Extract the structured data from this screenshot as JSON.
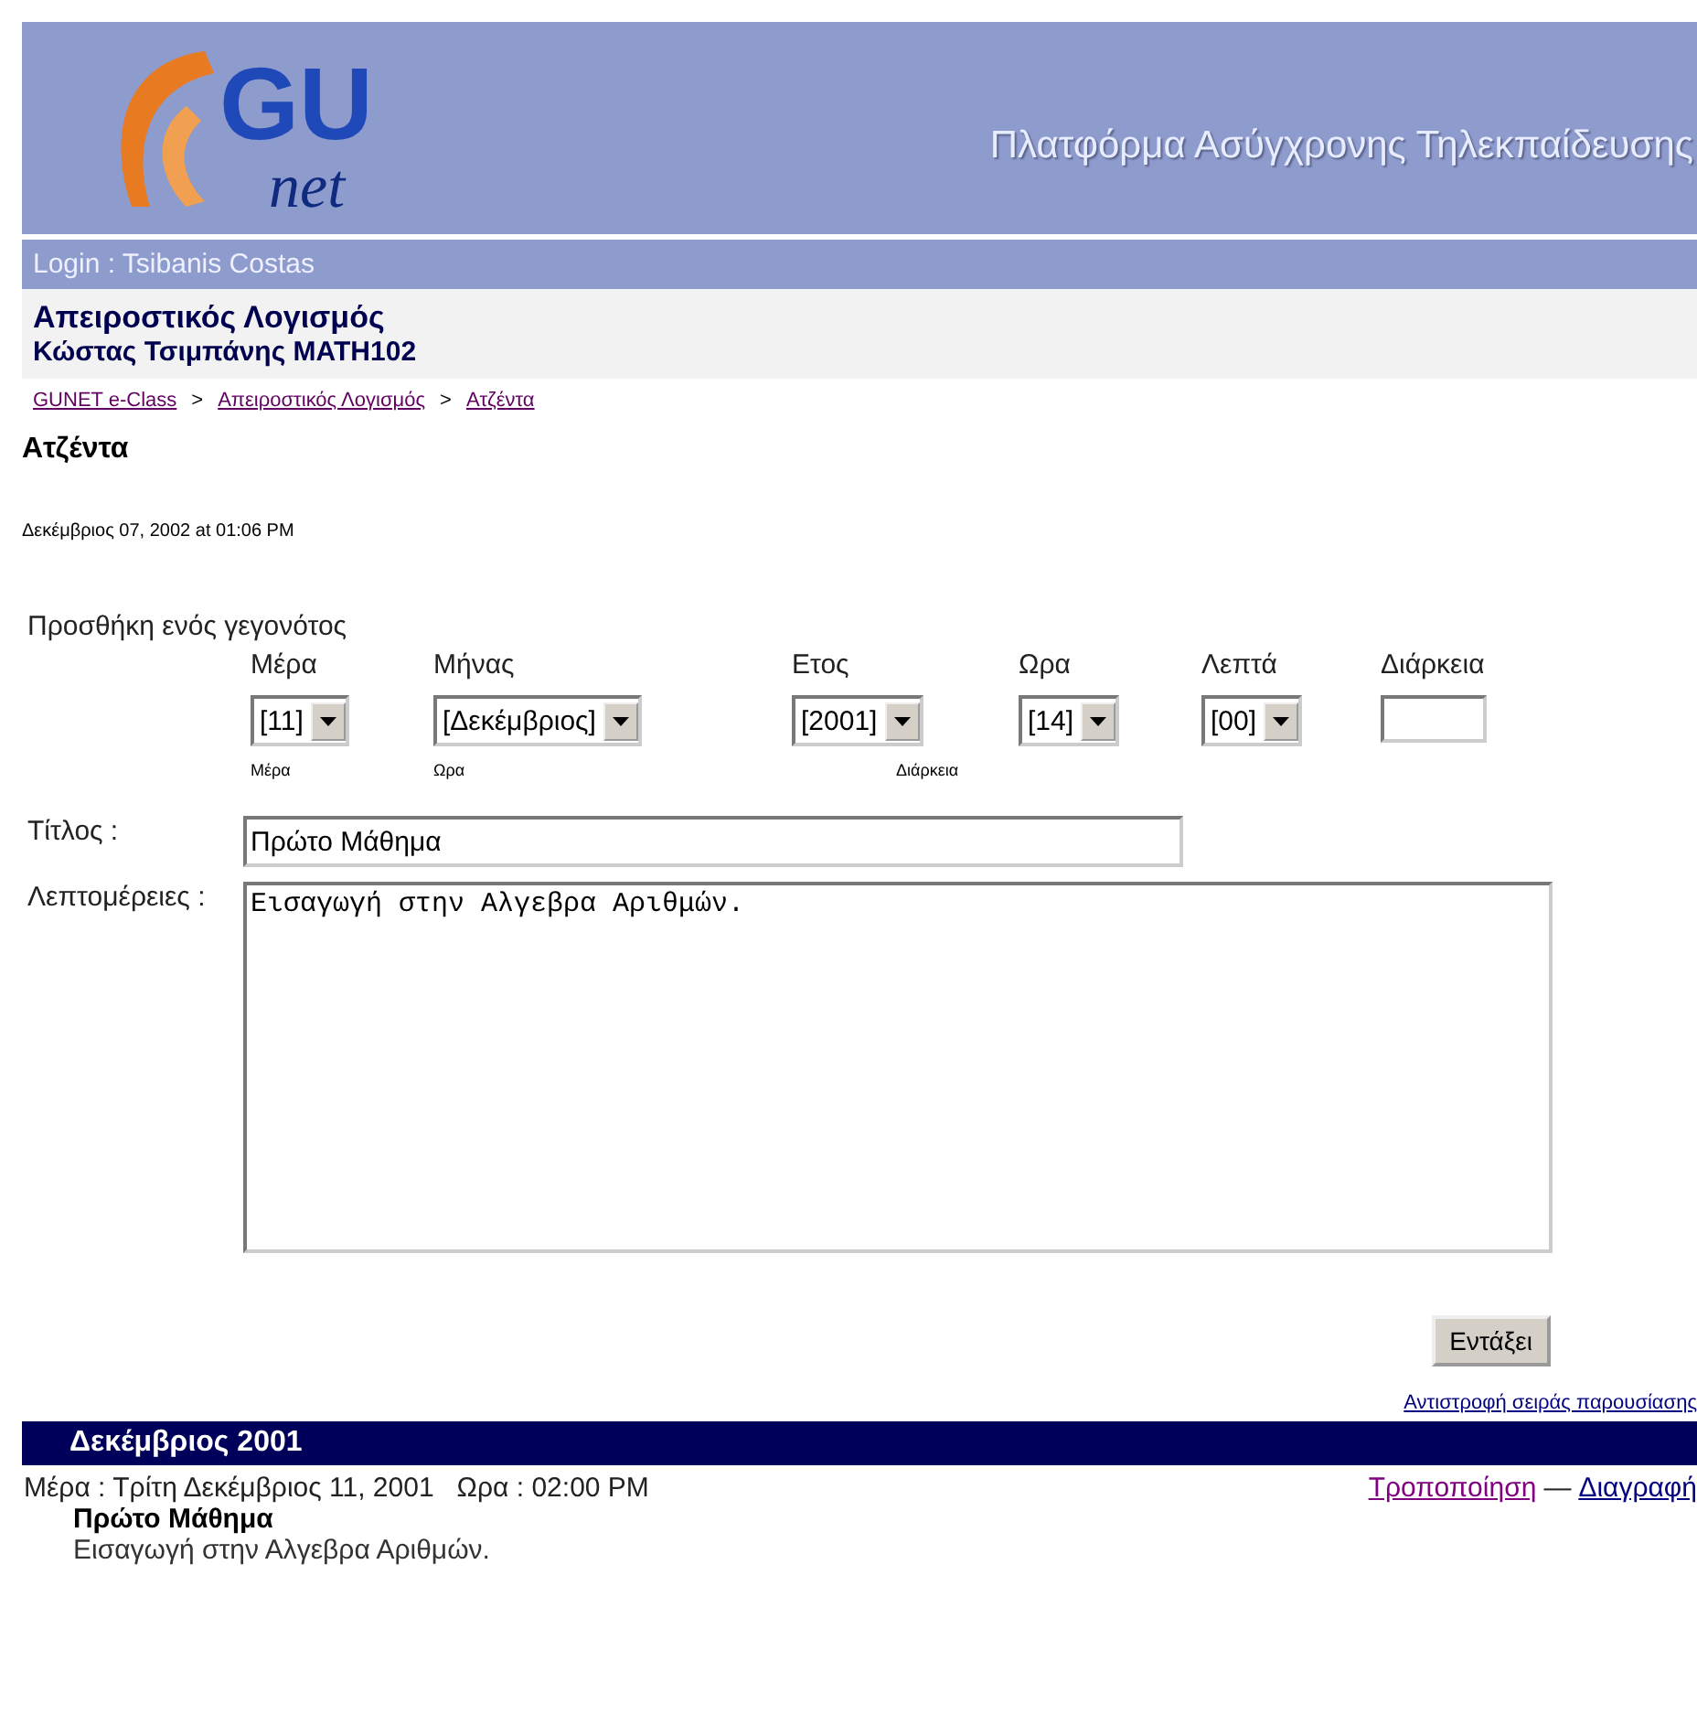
{
  "header": {
    "logo_main": "GU",
    "logo_sub": "net",
    "tagline": "Πλατφόρμα Ασύγχρονης Τηλεκπαίδευσης"
  },
  "login": "Login : Tsibanis Costas",
  "course": {
    "title": "Απειροστικός Λογισμός",
    "subtitle": "Κώστας Τσιμπάνης MATH102"
  },
  "breadcrumb": [
    "GUNET e-Class",
    "Απειροστικός Λογισμός",
    "Ατζέντα"
  ],
  "breadcrumb_separator": ">",
  "page_title": "Ατζέντα",
  "timestamp": "Δεκέμβριος 07, 2002 at 01:06 PM",
  "form": {
    "heading": "Προσθήκη ενός γεγονότος",
    "fields": [
      {
        "label": "Μέρα",
        "kind": "select",
        "value": "[11]"
      },
      {
        "label": "Μήνας",
        "kind": "select",
        "value": "[Δεκέμβριος]"
      },
      {
        "label": "Ετος",
        "kind": "select",
        "value": "[2001]"
      },
      {
        "label": "Ωρα",
        "kind": "select",
        "value": "[14]"
      },
      {
        "label": "Λεπτά",
        "kind": "select",
        "value": "[00]"
      },
      {
        "label": "Διάρκεια",
        "kind": "input"
      }
    ],
    "hints": [
      "Μέρα",
      "Ωρα",
      "Διάρκεια"
    ],
    "title_label": "Τίτλος :",
    "title_value": "Πρώτο Μάθημα",
    "details_label": "Λεπτομέρειες :",
    "details_value": "Εισαγωγή στην Αλγεβρα Αριθμών.",
    "submit": "Εντάξει"
  },
  "reverse_link": "Αντιστροφή σειράς παρουσίασης",
  "month_bar": "Δεκέμβριος 2001",
  "events": [
    {
      "when": "Μέρα : Τρίτη Δεκέμβριος 11, 2001   Ωρα : 02:00 PM",
      "edit": "Τροποποίηση",
      "separator": "—",
      "delete": "Διαγραφή",
      "title": "Πρώτο Μάθημα",
      "details": "Εισαγωγή στην Αλγεβρα Αριθμών."
    }
  ]
}
